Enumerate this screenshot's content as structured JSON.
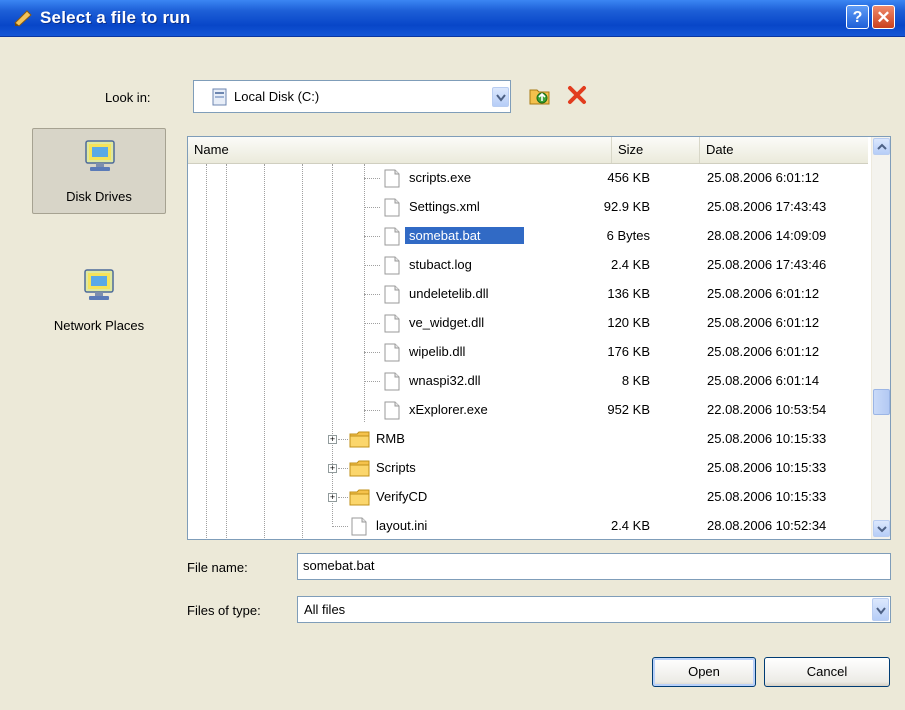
{
  "window": {
    "title": "Select a file to run"
  },
  "look_in": {
    "label": "Look in:",
    "value": "Local Disk (C:)"
  },
  "places": [
    {
      "label": "Disk Drives",
      "selected": true
    },
    {
      "label": "Network Places",
      "selected": false
    }
  ],
  "columns": {
    "name": "Name",
    "size": "Size",
    "date": "Date"
  },
  "files": [
    {
      "name": "scripts.exe",
      "size": "456 KB",
      "date": "25.08.2006 6:01:12",
      "type": "file"
    },
    {
      "name": "Settings.xml",
      "size": "92.9 KB",
      "date": "25.08.2006 17:43:43",
      "type": "file"
    },
    {
      "name": "somebat.bat",
      "size": "6 Bytes",
      "date": "28.08.2006 14:09:09",
      "type": "file",
      "selected": true
    },
    {
      "name": "stubact.log",
      "size": "2.4 KB",
      "date": "25.08.2006 17:43:46",
      "type": "file"
    },
    {
      "name": "undeletelib.dll",
      "size": "136 KB",
      "date": "25.08.2006 6:01:12",
      "type": "file"
    },
    {
      "name": "ve_widget.dll",
      "size": "120 KB",
      "date": "25.08.2006 6:01:12",
      "type": "file"
    },
    {
      "name": "wipelib.dll",
      "size": "176 KB",
      "date": "25.08.2006 6:01:12",
      "type": "file"
    },
    {
      "name": "wnaspi32.dll",
      "size": "8 KB",
      "date": "25.08.2006 6:01:14",
      "type": "file"
    },
    {
      "name": "xExplorer.exe",
      "size": "952 KB",
      "date": "22.08.2006 10:53:54",
      "type": "file"
    },
    {
      "name": "RMB",
      "size": "",
      "date": "25.08.2006 10:15:33",
      "type": "folder"
    },
    {
      "name": "Scripts",
      "size": "",
      "date": "25.08.2006 10:15:33",
      "type": "folder"
    },
    {
      "name": "VerifyCD",
      "size": "",
      "date": "25.08.2006 10:15:33",
      "type": "folder"
    },
    {
      "name": "layout.ini",
      "size": "2.4 KB",
      "date": "28.08.2006 10:52:34",
      "type": "file"
    }
  ],
  "file_name": {
    "label": "File name:",
    "value": "somebat.bat"
  },
  "file_type": {
    "label": "Files of type:",
    "value": "All files"
  },
  "buttons": {
    "open": "Open",
    "cancel": "Cancel",
    "help": "?",
    "close": "✕"
  }
}
